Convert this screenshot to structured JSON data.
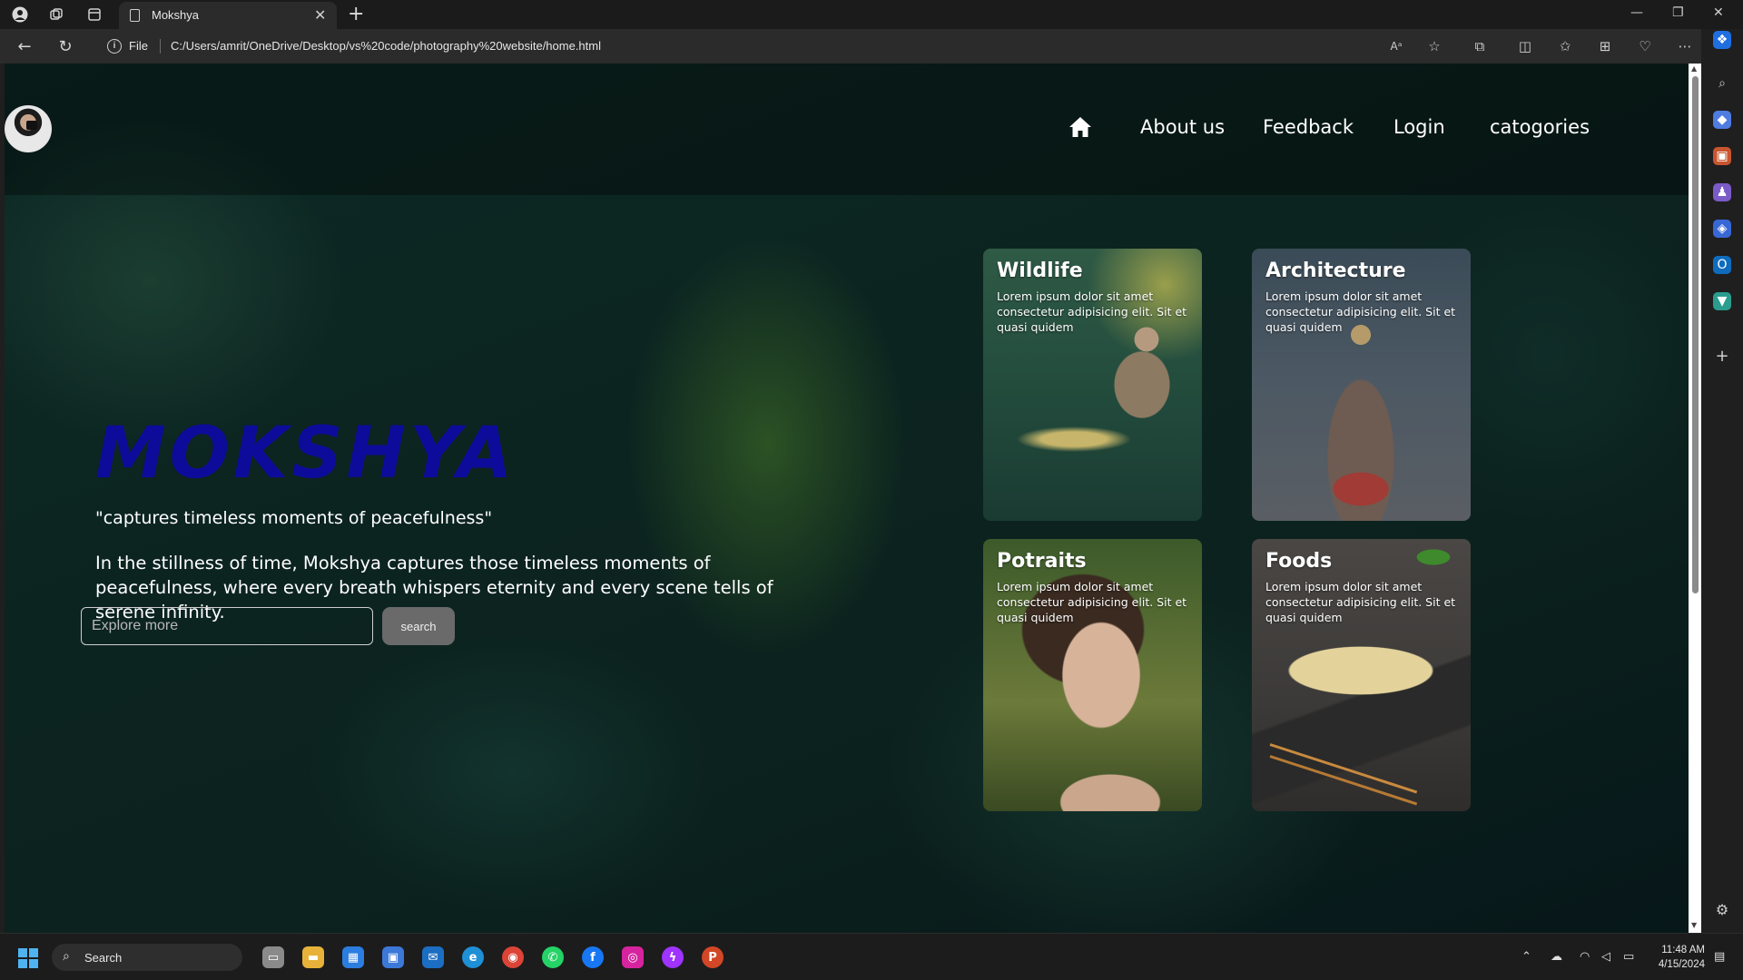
{
  "browser": {
    "tab_title": "Mokshya",
    "file_label": "File",
    "url": "C:/Users/amrit/OneDrive/Desktop/vs%20code/photography%20website/home.html"
  },
  "nav": {
    "about": "About us",
    "feedback": "Feedback",
    "login": "Login",
    "categories": "catogories"
  },
  "hero": {
    "title": "MOKSHYA",
    "tagline": "\"captures timeless moments of peacefulness\"",
    "description": "In the stillness of time, Mokshya captures those timeless moments of peacefulness, where every breath whispers eternity and every scene tells of serene infinity.",
    "search_placeholder": "Explore more",
    "search_button": "search"
  },
  "cards": [
    {
      "title": "Wildlife",
      "text": "Lorem ipsum dolor sit amet consectetur adipisicing elit. Sit et quasi quidem"
    },
    {
      "title": "Architecture",
      "text": "Lorem ipsum dolor sit amet consectetur adipisicing elit. Sit et quasi quidem"
    },
    {
      "title": "Potraits",
      "text": "Lorem ipsum dolor sit amet consectetur adipisicing elit. Sit et quasi quidem"
    },
    {
      "title": "Foods",
      "text": "Lorem ipsum dolor sit amet consectetur adipisicing elit. Sit et quasi quidem"
    }
  ],
  "taskbar": {
    "search_label": "Search",
    "time": "11:48 AM",
    "date": "4/15/2024"
  },
  "colors": {
    "hero_title": "#0d0b9a",
    "page_bg": "#0c2420",
    "browser_chrome": "#2b2b2b"
  }
}
